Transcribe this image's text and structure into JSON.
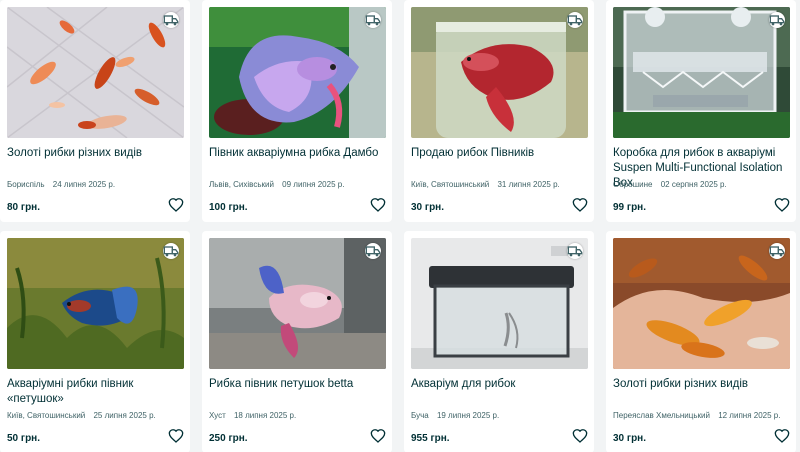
{
  "listings": [
    {
      "title": "Золоті рибки різних видів",
      "location": "Бориспіль",
      "date": "24 липня 2025 р.",
      "price": "80 грн.",
      "image": "koi-goldfish-photo"
    },
    {
      "title": "Півник акваріумна рибка Дамбо",
      "location": "Львів, Сихівський",
      "date": "09 липня 2025 р.",
      "price": "100 грн.",
      "image": "betta-dumbo-photo"
    },
    {
      "title": "Продаю рибок Півників",
      "location": "Київ, Святошинський",
      "date": "31 липня 2025 р.",
      "price": "30 грн.",
      "image": "betta-red-photo"
    },
    {
      "title": "Коробка для рибок в акваріумі Suspen Multi-Functional Isolation Box",
      "location": "Оброшине",
      "date": "02 серпня 2025 р.",
      "price": "99 грн.",
      "image": "isolation-box-photo"
    },
    {
      "title": "Акваріумні рибки півник «петушок»",
      "location": "Київ, Святошинський",
      "date": "25 липня 2025 р.",
      "price": "50 грн.",
      "image": "betta-blue-photo"
    },
    {
      "title": "Рибка півник петушок betta",
      "location": "Хуст",
      "date": "18 липня 2025 р.",
      "price": "250 грн.",
      "image": "betta-pink-photo"
    },
    {
      "title": "Акваріум для рибок",
      "location": "Буча",
      "date": "19 липня 2025 р.",
      "price": "955 грн.",
      "image": "aquarium-tank-photo"
    },
    {
      "title": "Золоті рибки різних видів",
      "location": "Переяслав Хмельницький",
      "date": "12 липня 2025 р.",
      "price": "30 грн.",
      "image": "goldfish-hand-photo"
    }
  ],
  "icons": {
    "delivery": "delivery-truck-icon",
    "favorite": "heart-outline-icon"
  },
  "colors": {
    "page_bg": "#f2f4f5",
    "card_bg": "#ffffff",
    "text": "#002f34",
    "meta": "#406367"
  }
}
